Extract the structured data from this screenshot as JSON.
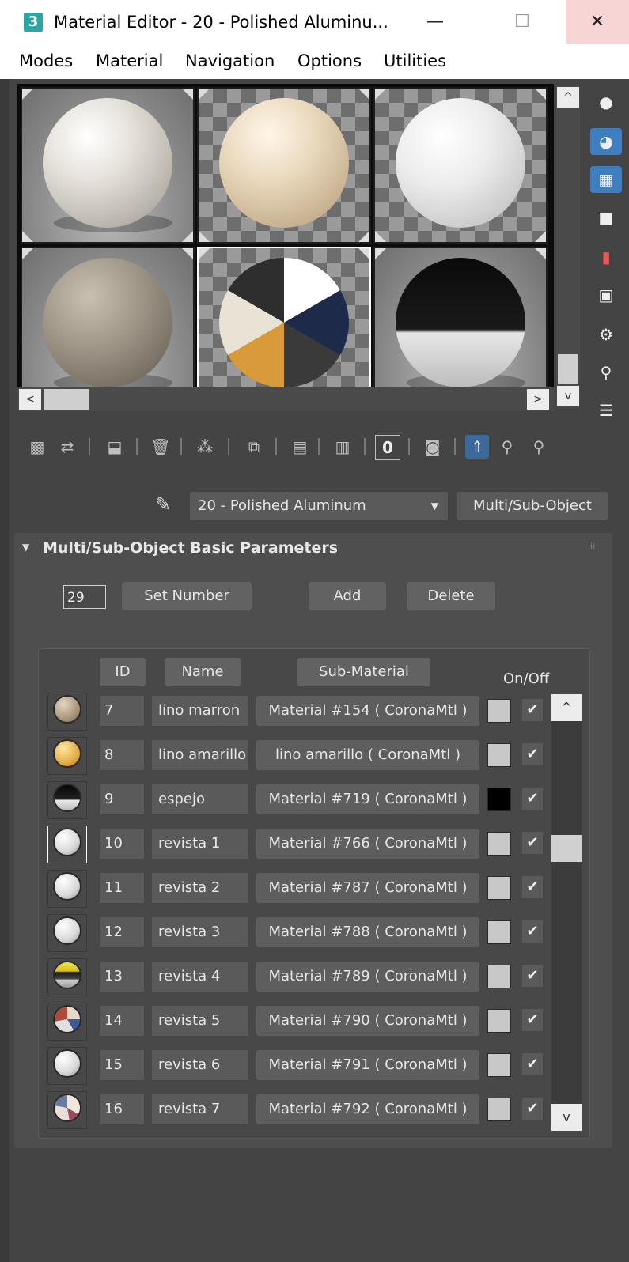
{
  "window": {
    "app_icon": "3",
    "title": "Material Editor - 20 - Polished Aluminu...",
    "minimize": "—",
    "maximize": "☐",
    "close": "✕"
  },
  "menu": [
    "Modes",
    "Material",
    "Navigation",
    "Options",
    "Utilities"
  ],
  "scroll": {
    "up": "^",
    "down": "v",
    "left": "<",
    "right": ">"
  },
  "material_selector": {
    "current": "20 - Polished Aluminum",
    "type_button": "Multi/Sub-Object"
  },
  "rollout": {
    "arrow": "▼",
    "title": "Multi/Sub-Object Basic Parameters",
    "number_value": "29",
    "set_number": "Set Number",
    "add": "Add",
    "delete": "Delete",
    "headers": {
      "id": "ID",
      "name": "Name",
      "sub_material": "Sub-Material",
      "on_off": "On/Off"
    }
  },
  "rows": [
    {
      "id": "7",
      "name": "lino marron",
      "sub": "Material #154  ( CoronaMtl )",
      "check": "✔"
    },
    {
      "id": "8",
      "name": "lino amarillo",
      "sub": "lino amarillo  ( CoronaMtl )",
      "check": "✔"
    },
    {
      "id": "9",
      "name": "espejo",
      "sub": "Material #719  ( CoronaMtl )",
      "check": "✔"
    },
    {
      "id": "10",
      "name": "revista 1",
      "sub": "Material #766  ( CoronaMtl )",
      "check": "✔"
    },
    {
      "id": "11",
      "name": "revista 2",
      "sub": "Material #787  ( CoronaMtl )",
      "check": "✔"
    },
    {
      "id": "12",
      "name": "revista 3",
      "sub": "Material #788  ( CoronaMtl )",
      "check": "✔"
    },
    {
      "id": "13",
      "name": "revista 4",
      "sub": "Material #789  ( CoronaMtl )",
      "check": "✔"
    },
    {
      "id": "14",
      "name": "revista 5",
      "sub": "Material #790  ( CoronaMtl )",
      "check": "✔"
    },
    {
      "id": "15",
      "name": "revista 6",
      "sub": "Material #791  ( CoronaMtl )",
      "check": "✔"
    },
    {
      "id": "16",
      "name": "revista 7",
      "sub": "Material #792  ( CoronaMtl )",
      "check": "✔"
    }
  ],
  "colors": {
    "panel": "#444444",
    "accent": "#3f7fc0",
    "swatch_default": "#c8c8c8",
    "swatch_black": "#000000"
  }
}
